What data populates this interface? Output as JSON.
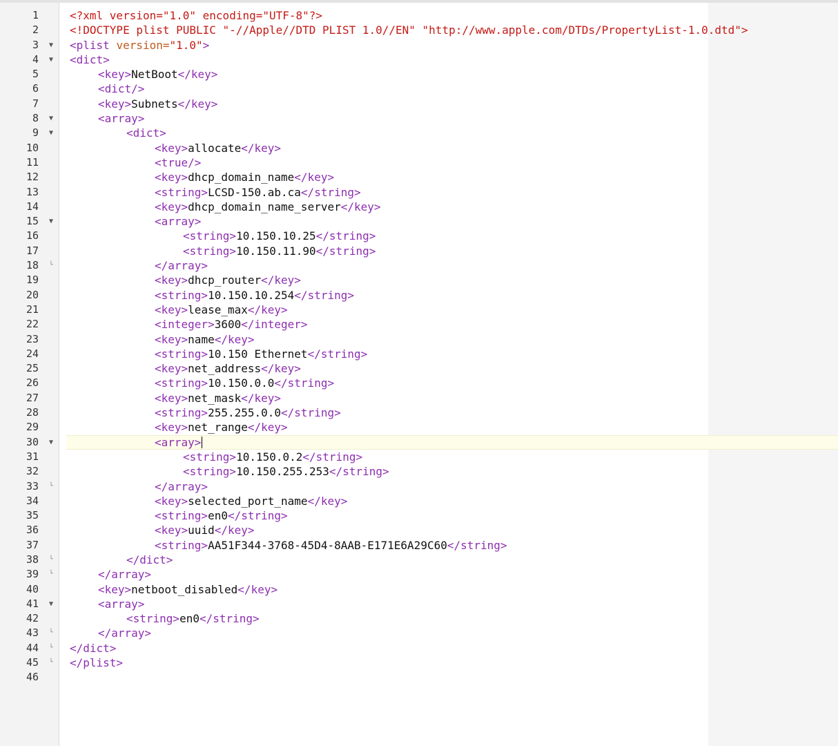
{
  "editor": {
    "current_line": 30,
    "lines": [
      {
        "n": "1",
        "indent": 0,
        "fold": "",
        "seg": [
          [
            "decl",
            "<?xml version=\"1.0\" encoding=\"UTF-8\"?>"
          ]
        ]
      },
      {
        "n": "2",
        "indent": 0,
        "fold": "",
        "seg": [
          [
            "decl",
            "<!DOCTYPE plist PUBLIC \"-//Apple//DTD PLIST 1.0//EN\" \"http://www.apple.com/DTDs/PropertyList-1.0.dtd\">"
          ]
        ]
      },
      {
        "n": "3",
        "indent": 0,
        "fold": "open",
        "seg": [
          [
            "tag",
            "<plist "
          ],
          [
            "attr",
            "version="
          ],
          [
            "val",
            "\"1.0\""
          ],
          [
            "tag",
            ">"
          ]
        ]
      },
      {
        "n": "4",
        "indent": 0,
        "fold": "open",
        "seg": [
          [
            "tag",
            "<dict>"
          ]
        ]
      },
      {
        "n": "5",
        "indent": 1,
        "fold": "",
        "seg": [
          [
            "tag",
            "<key>"
          ],
          [
            "txt",
            "NetBoot"
          ],
          [
            "tag",
            "</key>"
          ]
        ]
      },
      {
        "n": "6",
        "indent": 1,
        "fold": "",
        "seg": [
          [
            "tag",
            "<dict/>"
          ]
        ]
      },
      {
        "n": "7",
        "indent": 1,
        "fold": "",
        "seg": [
          [
            "tag",
            "<key>"
          ],
          [
            "txt",
            "Subnets"
          ],
          [
            "tag",
            "</key>"
          ]
        ]
      },
      {
        "n": "8",
        "indent": 1,
        "fold": "open",
        "seg": [
          [
            "tag",
            "<array>"
          ]
        ]
      },
      {
        "n": "9",
        "indent": 2,
        "fold": "open",
        "seg": [
          [
            "tag",
            "<dict>"
          ]
        ]
      },
      {
        "n": "10",
        "indent": 3,
        "fold": "",
        "seg": [
          [
            "tag",
            "<key>"
          ],
          [
            "txt",
            "allocate"
          ],
          [
            "tag",
            "</key>"
          ]
        ]
      },
      {
        "n": "11",
        "indent": 3,
        "fold": "",
        "seg": [
          [
            "tag",
            "<true/>"
          ]
        ]
      },
      {
        "n": "12",
        "indent": 3,
        "fold": "",
        "seg": [
          [
            "tag",
            "<key>"
          ],
          [
            "txt",
            "dhcp_domain_name"
          ],
          [
            "tag",
            "</key>"
          ]
        ]
      },
      {
        "n": "13",
        "indent": 3,
        "fold": "",
        "seg": [
          [
            "tag",
            "<string>"
          ],
          [
            "txt",
            "LCSD-150.ab.ca"
          ],
          [
            "tag",
            "</string>"
          ]
        ]
      },
      {
        "n": "14",
        "indent": 3,
        "fold": "",
        "seg": [
          [
            "tag",
            "<key>"
          ],
          [
            "txt",
            "dhcp_domain_name_server"
          ],
          [
            "tag",
            "</key>"
          ]
        ]
      },
      {
        "n": "15",
        "indent": 3,
        "fold": "open",
        "seg": [
          [
            "tag",
            "<array>"
          ]
        ]
      },
      {
        "n": "16",
        "indent": 4,
        "fold": "",
        "seg": [
          [
            "tag",
            "<string>"
          ],
          [
            "txt",
            "10.150.10.25"
          ],
          [
            "tag",
            "</string>"
          ]
        ]
      },
      {
        "n": "17",
        "indent": 4,
        "fold": "",
        "seg": [
          [
            "tag",
            "<string>"
          ],
          [
            "txt",
            "10.150.11.90"
          ],
          [
            "tag",
            "</string>"
          ]
        ]
      },
      {
        "n": "18",
        "indent": 3,
        "fold": "end",
        "seg": [
          [
            "tag",
            "</array>"
          ]
        ]
      },
      {
        "n": "19",
        "indent": 3,
        "fold": "",
        "seg": [
          [
            "tag",
            "<key>"
          ],
          [
            "txt",
            "dhcp_router"
          ],
          [
            "tag",
            "</key>"
          ]
        ]
      },
      {
        "n": "20",
        "indent": 3,
        "fold": "",
        "seg": [
          [
            "tag",
            "<string>"
          ],
          [
            "txt",
            "10.150.10.254"
          ],
          [
            "tag",
            "</string>"
          ]
        ]
      },
      {
        "n": "21",
        "indent": 3,
        "fold": "",
        "seg": [
          [
            "tag",
            "<key>"
          ],
          [
            "txt",
            "lease_max"
          ],
          [
            "tag",
            "</key>"
          ]
        ]
      },
      {
        "n": "22",
        "indent": 3,
        "fold": "",
        "seg": [
          [
            "tag",
            "<integer>"
          ],
          [
            "txt",
            "3600"
          ],
          [
            "tag",
            "</integer>"
          ]
        ]
      },
      {
        "n": "23",
        "indent": 3,
        "fold": "",
        "seg": [
          [
            "tag",
            "<key>"
          ],
          [
            "txt",
            "name"
          ],
          [
            "tag",
            "</key>"
          ]
        ]
      },
      {
        "n": "24",
        "indent": 3,
        "fold": "",
        "seg": [
          [
            "tag",
            "<string>"
          ],
          [
            "txt",
            "10.150 Ethernet"
          ],
          [
            "tag",
            "</string>"
          ]
        ]
      },
      {
        "n": "25",
        "indent": 3,
        "fold": "",
        "seg": [
          [
            "tag",
            "<key>"
          ],
          [
            "txt",
            "net_address"
          ],
          [
            "tag",
            "</key>"
          ]
        ]
      },
      {
        "n": "26",
        "indent": 3,
        "fold": "",
        "seg": [
          [
            "tag",
            "<string>"
          ],
          [
            "txt",
            "10.150.0.0"
          ],
          [
            "tag",
            "</string>"
          ]
        ]
      },
      {
        "n": "27",
        "indent": 3,
        "fold": "",
        "seg": [
          [
            "tag",
            "<key>"
          ],
          [
            "txt",
            "net_mask"
          ],
          [
            "tag",
            "</key>"
          ]
        ]
      },
      {
        "n": "28",
        "indent": 3,
        "fold": "",
        "seg": [
          [
            "tag",
            "<string>"
          ],
          [
            "txt",
            "255.255.0.0"
          ],
          [
            "tag",
            "</string>"
          ]
        ]
      },
      {
        "n": "29",
        "indent": 3,
        "fold": "",
        "seg": [
          [
            "tag",
            "<key>"
          ],
          [
            "txt",
            "net_range"
          ],
          [
            "tag",
            "</key>"
          ]
        ]
      },
      {
        "n": "30",
        "indent": 3,
        "fold": "open",
        "seg": [
          [
            "tag",
            "<array>"
          ]
        ]
      },
      {
        "n": "31",
        "indent": 4,
        "fold": "",
        "seg": [
          [
            "tag",
            "<string>"
          ],
          [
            "txt",
            "10.150.0.2"
          ],
          [
            "tag",
            "</string>"
          ]
        ]
      },
      {
        "n": "32",
        "indent": 4,
        "fold": "",
        "seg": [
          [
            "tag",
            "<string>"
          ],
          [
            "txt",
            "10.150.255.253"
          ],
          [
            "tag",
            "</string>"
          ]
        ]
      },
      {
        "n": "33",
        "indent": 3,
        "fold": "end",
        "seg": [
          [
            "tag",
            "</array>"
          ]
        ]
      },
      {
        "n": "34",
        "indent": 3,
        "fold": "",
        "seg": [
          [
            "tag",
            "<key>"
          ],
          [
            "txt",
            "selected_port_name"
          ],
          [
            "tag",
            "</key>"
          ]
        ]
      },
      {
        "n": "35",
        "indent": 3,
        "fold": "",
        "seg": [
          [
            "tag",
            "<string>"
          ],
          [
            "txt",
            "en0"
          ],
          [
            "tag",
            "</string>"
          ]
        ]
      },
      {
        "n": "36",
        "indent": 3,
        "fold": "",
        "seg": [
          [
            "tag",
            "<key>"
          ],
          [
            "txt",
            "uuid"
          ],
          [
            "tag",
            "</key>"
          ]
        ]
      },
      {
        "n": "37",
        "indent": 3,
        "fold": "",
        "seg": [
          [
            "tag",
            "<string>"
          ],
          [
            "txt",
            "AA51F344-3768-45D4-8AAB-E171E6A29C60"
          ],
          [
            "tag",
            "</string>"
          ]
        ]
      },
      {
        "n": "38",
        "indent": 2,
        "fold": "end",
        "seg": [
          [
            "tag",
            "</dict>"
          ]
        ]
      },
      {
        "n": "39",
        "indent": 1,
        "fold": "end",
        "seg": [
          [
            "tag",
            "</array>"
          ]
        ]
      },
      {
        "n": "40",
        "indent": 1,
        "fold": "",
        "seg": [
          [
            "tag",
            "<key>"
          ],
          [
            "txt",
            "netboot_disabled"
          ],
          [
            "tag",
            "</key>"
          ]
        ]
      },
      {
        "n": "41",
        "indent": 1,
        "fold": "open",
        "seg": [
          [
            "tag",
            "<array>"
          ]
        ]
      },
      {
        "n": "42",
        "indent": 2,
        "fold": "",
        "seg": [
          [
            "tag",
            "<string>"
          ],
          [
            "txt",
            "en0"
          ],
          [
            "tag",
            "</string>"
          ]
        ]
      },
      {
        "n": "43",
        "indent": 1,
        "fold": "end",
        "seg": [
          [
            "tag",
            "</array>"
          ]
        ]
      },
      {
        "n": "44",
        "indent": 0,
        "fold": "end",
        "seg": [
          [
            "tag",
            "</dict>"
          ]
        ]
      },
      {
        "n": "45",
        "indent": 0,
        "fold": "end",
        "seg": [
          [
            "tag",
            "</plist>"
          ]
        ]
      },
      {
        "n": "46",
        "indent": 0,
        "fold": "",
        "seg": []
      }
    ]
  }
}
